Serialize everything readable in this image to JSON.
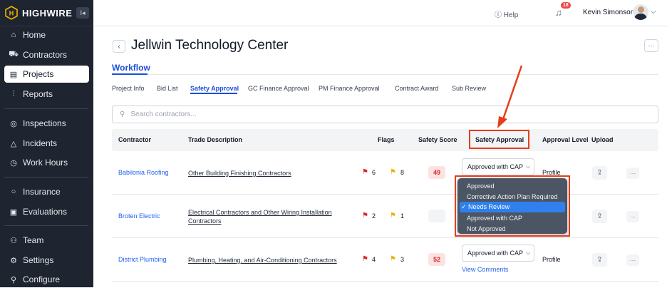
{
  "brand": {
    "name": "HIGHWIRE",
    "collapse_icon": "collapse-icon"
  },
  "sidebar": {
    "items": [
      {
        "label": "Home",
        "icon": "home-icon"
      },
      {
        "label": "Contractors",
        "icon": "contractors-icon"
      },
      {
        "label": "Projects",
        "icon": "projects-icon",
        "active": true
      },
      {
        "label": "Reports",
        "icon": "reports-icon"
      },
      {
        "label": "Inspections",
        "icon": "inspections-icon"
      },
      {
        "label": "Incidents",
        "icon": "incidents-icon"
      },
      {
        "label": "Work Hours",
        "icon": "clock-icon"
      },
      {
        "label": "Insurance",
        "icon": "insurance-icon"
      },
      {
        "label": "Evaluations",
        "icon": "evaluations-icon"
      },
      {
        "label": "Team",
        "icon": "team-icon"
      },
      {
        "label": "Settings",
        "icon": "gear-icon"
      },
      {
        "label": "Configure",
        "icon": "configure-icon"
      }
    ]
  },
  "topbar": {
    "help": "Help",
    "notifications": "18",
    "user": "Kevin Simonson"
  },
  "page": {
    "title": "Jellwin Technology Center",
    "section": "Workflow"
  },
  "subtabs": [
    "Project Info",
    "Bid List",
    "Safety Approval",
    "GC Finance Approval",
    "PM Finance Approval",
    "Contract Award",
    "Sub Review"
  ],
  "search": {
    "placeholder": "Search contractors..."
  },
  "table": {
    "headers": [
      "Contractor",
      "Trade Description",
      "Flags",
      "Safety Score",
      "Safety Approval",
      "Approval Level",
      "Upload"
    ],
    "rows": [
      {
        "contractor": "Babilonia Roofing",
        "trade": "Other Building Finishing Contractors",
        "red_flags": "6",
        "yellow_flags": "8",
        "score": "49",
        "approval": "Approved with CAP",
        "level": "Profile"
      },
      {
        "contractor": "Broten Electric",
        "trade": "Electrical Contractors and Other Wiring Installation Contractors",
        "red_flags": "2",
        "yellow_flags": "1",
        "score": "",
        "approval": "",
        "level": ""
      },
      {
        "contractor": "District Plumbing",
        "trade": "Plumbing, Heating, and Air-Conditioning Contractors",
        "red_flags": "4",
        "yellow_flags": "3",
        "score": "52",
        "approval": "Approved with CAP",
        "level": "Profile",
        "link": "View Comments"
      }
    ]
  },
  "dropdown": {
    "options": [
      "Approved",
      "Corrective Action Plan Required",
      "✓ Needs Review",
      "Approved with CAP",
      "Not Approved"
    ],
    "selected_index": 2
  },
  "colors": {
    "sidebar_bg": "#1e2430",
    "accent": "#1d4ed8",
    "annotation": "#e53e1b",
    "flag_red": "#dc2626",
    "flag_yellow": "#eab308"
  }
}
